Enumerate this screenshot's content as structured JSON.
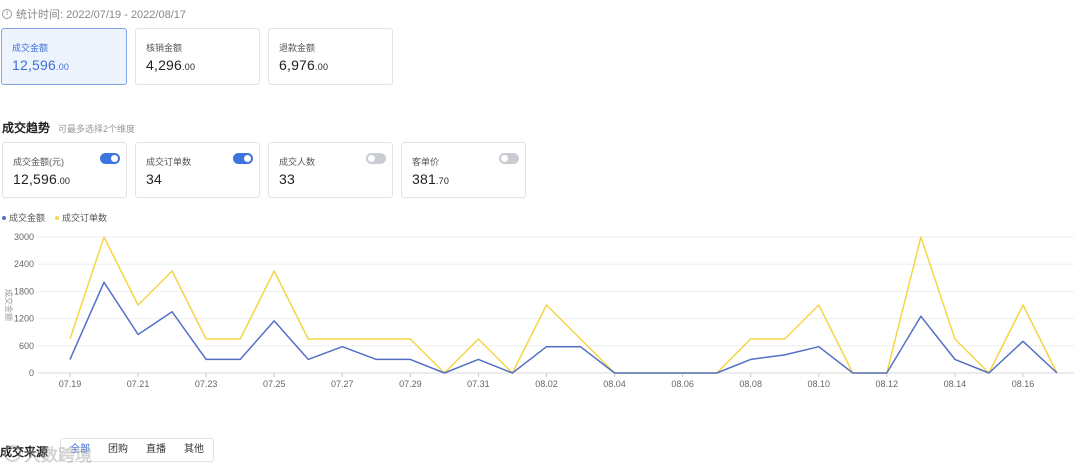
{
  "period": {
    "label": "统计时间: 2022/07/19 - 2022/08/17"
  },
  "summary": [
    {
      "label": "成交金额",
      "int": "12,596",
      "dec": ".00",
      "active": true
    },
    {
      "label": "核销金额",
      "int": "4,296",
      "dec": ".00",
      "active": false
    },
    {
      "label": "退款金额",
      "int": "6,976",
      "dec": ".00",
      "active": false
    }
  ],
  "trend": {
    "title": "成交趋势",
    "hint": "可最多选择2个维度",
    "metrics": [
      {
        "label": "成交金额(元)",
        "int": "12,596",
        "dec": ".00",
        "on": true
      },
      {
        "label": "成交订单数",
        "int": "34",
        "dec": "",
        "on": true
      },
      {
        "label": "成交人数",
        "int": "33",
        "dec": "",
        "on": false
      },
      {
        "label": "客单价",
        "int": "381",
        "dec": ".70",
        "on": false
      }
    ]
  },
  "colors": {
    "series_amount": "#5470c6",
    "series_orders": "#f5d547",
    "accent": "#3d6fd8"
  },
  "chart_data": {
    "type": "line",
    "ylabel": "成交金额",
    "ylim": [
      0,
      3000
    ],
    "yticks": [
      "0",
      "600",
      "1200",
      "1800",
      "2400",
      "3000"
    ],
    "x": [
      "07.19",
      "07.20",
      "07.21",
      "07.22",
      "07.23",
      "07.24",
      "07.25",
      "07.26",
      "07.27",
      "07.28",
      "07.29",
      "07.30",
      "07.31",
      "08.01",
      "08.02",
      "08.03",
      "08.04",
      "08.05",
      "08.06",
      "08.07",
      "08.08",
      "08.09",
      "08.10",
      "08.11",
      "08.12",
      "08.13",
      "08.14",
      "08.15",
      "08.16",
      "08.17"
    ],
    "xticks_shown": [
      "07.19",
      "07.21",
      "07.23",
      "07.25",
      "07.27",
      "07.29",
      "07.31",
      "08.02",
      "08.04",
      "08.06",
      "08.08",
      "08.10",
      "08.12",
      "08.14",
      "08.16"
    ],
    "series": [
      {
        "name": "成交金额",
        "values": [
          300,
          2000,
          850,
          1350,
          300,
          300,
          1150,
          300,
          580,
          300,
          300,
          0,
          300,
          0,
          580,
          580,
          0,
          0,
          0,
          0,
          300,
          400,
          580,
          0,
          0,
          1250,
          300,
          0,
          700,
          0
        ]
      },
      {
        "name": "成交订单数",
        "values": [
          750,
          3000,
          1500,
          2250,
          750,
          750,
          2250,
          750,
          750,
          750,
          750,
          0,
          750,
          0,
          1500,
          750,
          0,
          0,
          0,
          0,
          750,
          750,
          1500,
          0,
          0,
          3000,
          750,
          0,
          1500,
          0
        ]
      }
    ]
  },
  "source": {
    "title": "成交来源",
    "tabs": [
      "全部",
      "团购",
      "直播",
      "其他"
    ]
  },
  "watermark": "大数跨境"
}
